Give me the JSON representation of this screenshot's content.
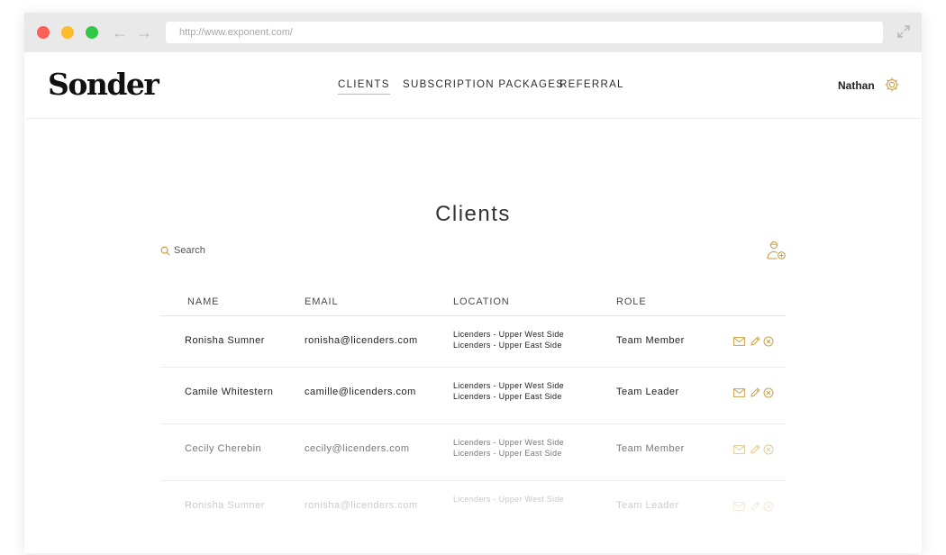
{
  "browser": {
    "url": "http://www.exponent.com/"
  },
  "header": {
    "logo": "Sonder",
    "nav": [
      {
        "label": "CLIENTS"
      },
      {
        "label": "SUBSCRIPTION PACKAGES"
      },
      {
        "label": "REFERRAL"
      }
    ],
    "user_name": "Nathan"
  },
  "main": {
    "title": "Clients",
    "search_label": "Search",
    "columns": {
      "name": "NAME",
      "email": "EMAIL",
      "location": "LOCATION",
      "role": "ROLE"
    },
    "rows": [
      {
        "name": "Ronisha Sumner",
        "email": "ronisha@licenders.com",
        "location_1": "Licenders - Upper West Side",
        "location_2": "Licenders - Upper East Side",
        "role": "Team Member"
      },
      {
        "name": "Camile Whitestern",
        "email": "camille@licenders.com",
        "location_1": "Licenders - Upper West Side",
        "location_2": "Licenders - Upper East Side",
        "role": "Team Leader"
      },
      {
        "name": "Cecily Cherebin",
        "email": "cecily@licenders.com",
        "location_1": "Licenders - Upper West Side",
        "location_2": "Licenders - Upper East Side",
        "role": "Team Member"
      },
      {
        "name": "Ronisha Sumner",
        "email": "ronisha@licenders.com",
        "location_1": "Licenders - Upper West Side",
        "location_2": "",
        "role": "Team Leader"
      }
    ]
  },
  "colors": {
    "accent": "#c8a24a",
    "text": "#222222"
  },
  "icons": {
    "settings": "gear-icon",
    "search": "search-icon",
    "add_user": "add-user-icon",
    "mail": "mail-icon",
    "edit": "pencil-icon",
    "remove": "remove-icon"
  }
}
